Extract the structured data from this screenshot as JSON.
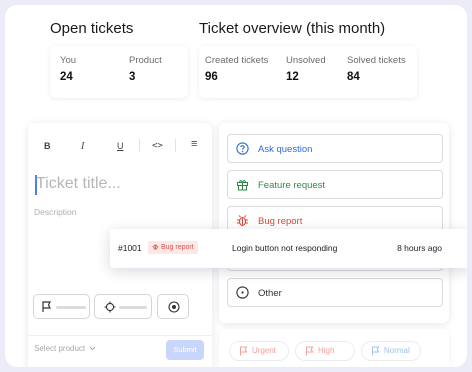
{
  "open_tickets": {
    "title": "Open tickets",
    "stats": [
      {
        "label": "You",
        "value": "24"
      },
      {
        "label": "Product",
        "value": "3"
      }
    ]
  },
  "overview": {
    "title": "Ticket overview (this month)",
    "stats": [
      {
        "label": "Created tickets",
        "value": "96"
      },
      {
        "label": "Unsolved",
        "value": "12"
      },
      {
        "label": "Solved tickets",
        "value": "84"
      }
    ]
  },
  "editor": {
    "toolbar": {
      "bold": "B",
      "italic": "I",
      "underline": "U",
      "code": "<>",
      "list": "≡"
    },
    "title_placeholder": "Ticket title...",
    "description_placeholder": "Description",
    "select_product": "Select product",
    "submit": "Submit"
  },
  "categories": [
    {
      "label": "Ask question",
      "icon": "question-circle-icon",
      "color": "#2d6bdc"
    },
    {
      "label": "Feature request",
      "icon": "gift-icon",
      "color": "#2f8a4a"
    },
    {
      "label": "Bug report",
      "icon": "bug-icon",
      "color": "#d64b3b"
    },
    {
      "label": "Other",
      "icon": "circle-dot-icon",
      "color": "#333333"
    }
  ],
  "notification": {
    "id": "#1001",
    "badge": "Bug report",
    "message": "Login button not responding",
    "time": "8 hours ago"
  },
  "priorities": [
    {
      "label": "Urgent",
      "color": "#f2a29a"
    },
    {
      "label": "High",
      "color": "#f2a29a"
    },
    {
      "label": "Normal",
      "color": "#9fc0f2"
    }
  ]
}
